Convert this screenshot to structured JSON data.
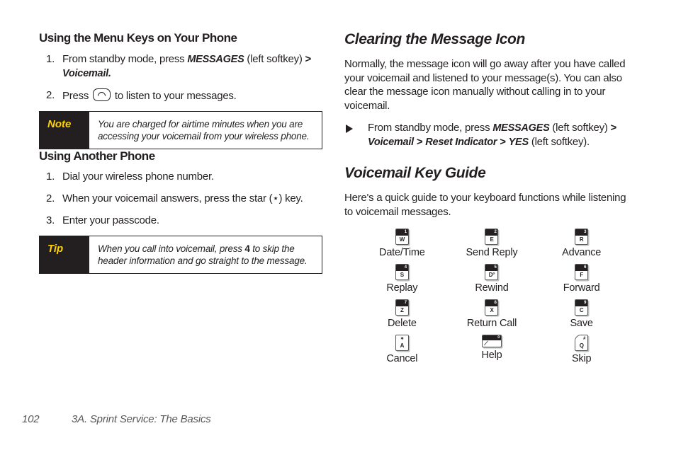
{
  "left_column": {
    "heading_menu_keys": "Using the Menu Keys on Your Phone",
    "steps_menu_keys": [
      {
        "num": "1.",
        "text_before": "From standby mode, press ",
        "emph1": "MESSAGES",
        "text_mid": " (left softkey) ",
        "gt": ">",
        "emph2": "Voicemail",
        "text_after": "."
      },
      {
        "num": "2.",
        "text_before": "Press ",
        "key_icon": "talk-key-icon",
        "text_after": " to listen to your messages."
      }
    ],
    "note_callout": {
      "label": "Note",
      "text": "You are charged for airtime minutes when you are accessing your voicemail from your wireless phone."
    },
    "heading_another_phone": "Using Another Phone",
    "steps_another_phone": [
      {
        "num": "1.",
        "text": "Dial your wireless phone number."
      },
      {
        "num": "2.",
        "text": "When your voicemail answers, press the star (⋆) key."
      },
      {
        "num": "3.",
        "text": "Enter your passcode."
      }
    ],
    "tip_callout": {
      "label": "Tip",
      "text_before": "When you call into voicemail, press ",
      "bold": "4",
      "text_after": " to skip the header information and go straight to the message."
    }
  },
  "right_column": {
    "heading_clearing": "Clearing the Message Icon",
    "paragraph_clearing": "Normally, the message icon will go away after you have called your voicemail and listened to your message(s). You can also clear the message icon manually without calling in to your voicemail.",
    "bullet_clearing": {
      "text_before": "From standby mode, press ",
      "emph1": "MESSAGES",
      "text_mid": " (left softkey) ",
      "gt1": ">",
      "emph2": "Voicemail",
      "gt2": ">",
      "emph3": "Reset Indicator",
      "gt3": ">",
      "emph4": "YES",
      "text_after": " (left softkey)."
    },
    "heading_key_guide": "Voicemail Key Guide",
    "paragraph_key_guide": "Here's a quick guide to your keyboard functions while listening to voicemail messages.",
    "keys": [
      {
        "number": "1",
        "letter": "W",
        "label": "Date/Time",
        "style": "standard"
      },
      {
        "number": "2",
        "letter": "E",
        "label": "Send Reply",
        "style": "standard"
      },
      {
        "number": "3",
        "letter": "R",
        "label": "Advance",
        "style": "standard"
      },
      {
        "number": "4",
        "letter": "S",
        "label": "Replay",
        "style": "standard"
      },
      {
        "number": "5",
        "letter": "D°",
        "label": "Rewind",
        "style": "standard"
      },
      {
        "number": "6",
        "letter": "F",
        "label": "Forward",
        "style": "standard"
      },
      {
        "number": "7",
        "letter": "Z",
        "label": "Delete",
        "style": "standard"
      },
      {
        "number": "8",
        "letter": "X",
        "label": "Return Call",
        "style": "standard"
      },
      {
        "number": "9",
        "letter": "C",
        "label": "Save",
        "style": "standard"
      },
      {
        "number": "∗",
        "letter": "A",
        "label": "Cancel",
        "style": "plain"
      },
      {
        "number": "0",
        "letter": "⁄",
        "label": "Help",
        "style": "wide"
      },
      {
        "number": "#",
        "letter": "Q",
        "label": "Skip",
        "style": "corner"
      }
    ]
  },
  "footer": {
    "page_number": "102",
    "section_title": "3A. Sprint Service: The Basics"
  },
  "colors": {
    "text": "#231f20",
    "callout_bg": "#231f20",
    "callout_label": "#ffd200",
    "footer_text": "#58595b",
    "key_border": "#58595b"
  }
}
